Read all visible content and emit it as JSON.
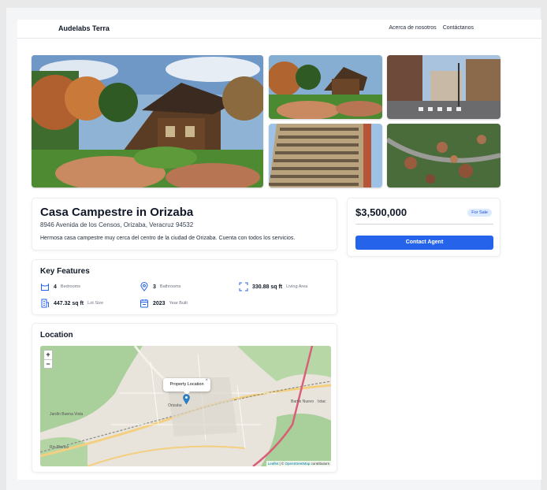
{
  "header": {
    "brand": "Audelabs Terra",
    "nav": [
      "Acerca de nosotros",
      "Contáctanos"
    ]
  },
  "gallery": {
    "photos": [
      "house-main",
      "house-secondary",
      "street-crossing",
      "apartment-building",
      "aerial-neighborhood"
    ]
  },
  "property": {
    "title": "Casa Campestre in Orizaba",
    "address": "8946 Avenida de los Censos, Orizaba, Veracruz 94532",
    "description": "Hermosa casa campestre muy cerca del centro de la ciudad de Orizaba. Cuenta con todos los servicios."
  },
  "pricing": {
    "price": "$3,500,000",
    "status": "For Sale",
    "contact_label": "Contact Agent",
    "accent": "#2563eb"
  },
  "features": {
    "title": "Key Features",
    "items": [
      {
        "icon": "bed-icon",
        "value": "4",
        "label": "Bedrooms"
      },
      {
        "icon": "location-pin-icon",
        "value": "3",
        "label": "Bathrooms"
      },
      {
        "icon": "expand-icon",
        "value": "330.88 sq ft",
        "label": "Living Area"
      },
      {
        "icon": "building-icon",
        "value": "447.32 sq ft",
        "label": "Lot Size"
      },
      {
        "icon": "calendar-icon",
        "value": "2023",
        "label": "Year Built"
      }
    ]
  },
  "location": {
    "title": "Location",
    "zoom_in": "+",
    "zoom_out": "−",
    "popup": "Property Location",
    "popup_close": "×",
    "labels": [
      "Orizaba",
      "Ixtac",
      "Rio Blanco",
      "Barrio Nuevo",
      "Jardín Buena Vista"
    ],
    "attribution_leaflet": "Leaflet",
    "attribution_sep": " | © ",
    "attribution_osm": "OpenStreetMap",
    "attribution_tail": " contributors"
  }
}
